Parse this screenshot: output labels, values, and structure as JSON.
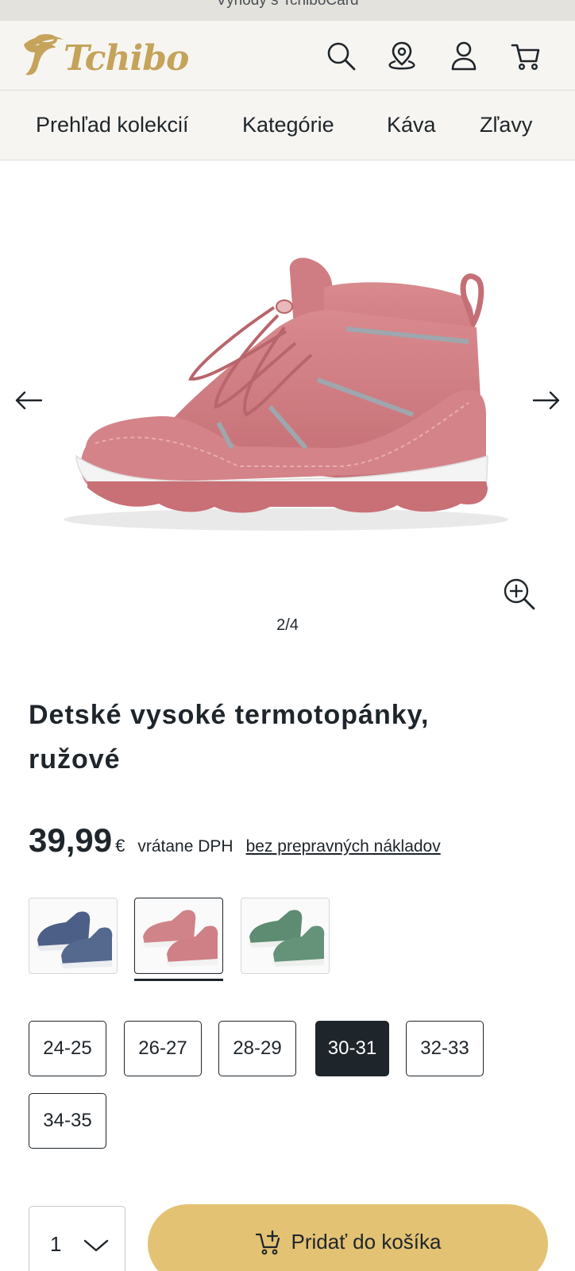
{
  "promo": {
    "text": "Výhody s TchiboCard"
  },
  "header": {
    "logo_text": "Tchibo",
    "icons": [
      "search-icon",
      "store-locator-icon",
      "account-icon",
      "cart-icon"
    ]
  },
  "nav": {
    "items": [
      "Prehľad kolekcií",
      "Kategórie",
      "Káva",
      "Zľavy"
    ]
  },
  "gallery": {
    "counter": "2/4",
    "prev_icon": "arrow-left-icon",
    "next_icon": "arrow-right-icon",
    "zoom_icon": "zoom-in-icon"
  },
  "product": {
    "title": "Detské vysoké termotopánky, ružové",
    "price": "39,99",
    "currency": "€",
    "vat_text": "vrátane DPH",
    "shipping_link": "bez prepravných nákladov"
  },
  "colors": {
    "options": [
      "blue",
      "pink",
      "green"
    ],
    "selected": "pink"
  },
  "sizes": {
    "options": [
      "24-25",
      "26-27",
      "28-29",
      "30-31",
      "32-33",
      "34-35"
    ],
    "selected": "30-31"
  },
  "purchase": {
    "quantity": "1",
    "add_to_cart_label": "Pridať do košíka"
  },
  "theme": {
    "brand_gold": "#c5a35a",
    "button_gold": "#e3c273",
    "ink": "#1e252b",
    "header_bg": "#f7f5f1"
  }
}
